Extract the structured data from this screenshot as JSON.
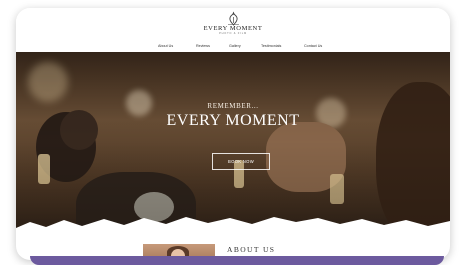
{
  "brand": {
    "name": "EVERY MOMENT",
    "tagline": "PHOTO & FILM"
  },
  "nav": {
    "items": [
      "About Us",
      "Reviews",
      "Gallery",
      "Testimonials",
      "Contact Us"
    ]
  },
  "hero": {
    "eyebrow": "REMEMBER...",
    "headline": "EVERY MOMENT",
    "button_label": "BOOK NOW"
  },
  "about": {
    "title": "ABOUT US"
  },
  "colors": {
    "accent": "#6c5a9e",
    "header_bg": "#ffffff",
    "hero_overlay_text": "#ffffff"
  }
}
